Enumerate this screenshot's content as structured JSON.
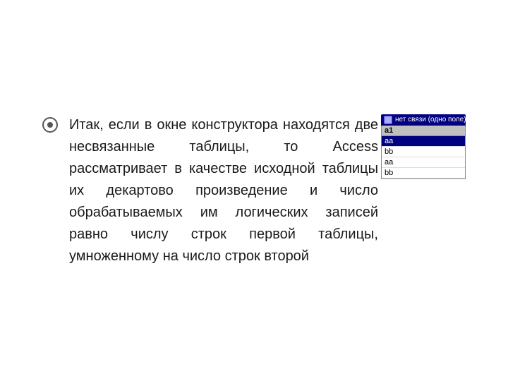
{
  "slide": {
    "background": "#ffffff"
  },
  "bullet": {
    "text_parts": {
      "part1": "Итак, если в окне конструктора находятся две несвязанные таблицы, то ",
      "access": "Access",
      "part2": " рассматривает в качестве исходной таблицы их декартово произведение и число обрабатываемых им логических записей равно числу строк первой таблицы, умноженному на число строк второй"
    },
    "full_text": "Итак, если в окне конструктора находятся две несвязанные таблицы, то Access рассматривает в качестве исходной таблицы их декартово произведение и число обрабатываемых им логических записей равно числу строк первой таблицы, умноженному на число строк второй"
  },
  "widget": {
    "titlebar": "нет связи (одно поле)",
    "titlebar_icon": "db-icon",
    "column": "a1",
    "rows": [
      "aa",
      "bb",
      "aa",
      "bb"
    ]
  }
}
